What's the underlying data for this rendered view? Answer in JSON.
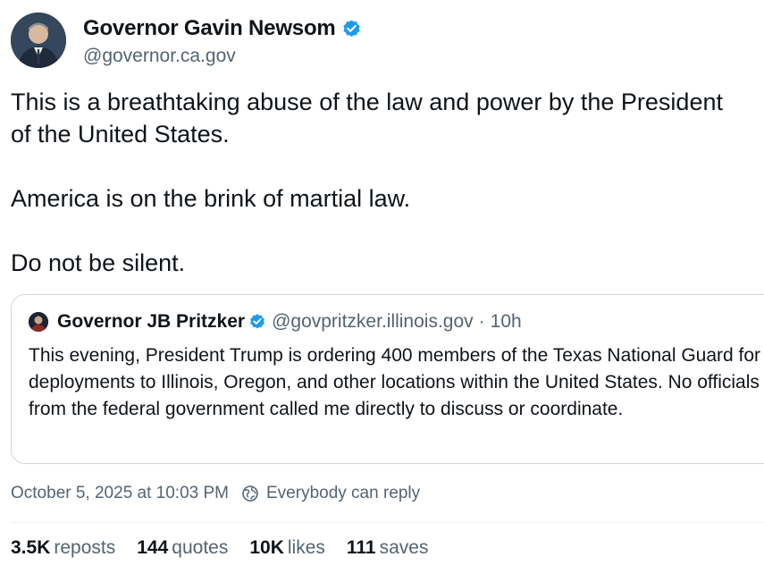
{
  "author": {
    "display_name": "Governor Gavin Newsom",
    "handle": "@governor.ca.gov",
    "verified_icon": "verified-badge-icon",
    "accent_color": "#1d9bf0"
  },
  "post": {
    "paragraphs": [
      "This is a breathtaking abuse of the law and power by the President of the United States.",
      "America is on the brink of martial law.",
      "Do not be silent."
    ]
  },
  "quote": {
    "display_name": "Governor JB Pritzker",
    "handle": "@govpritzker.illinois.gov",
    "separator": "·",
    "time": "10h",
    "text": "This evening, President Trump is ordering 400 members of the Texas National Guard for deployments to Illinois, Oregon, and other locations within the United States. No officials from the federal government called me directly to discuss or coordinate."
  },
  "meta": {
    "timestamp": "October 5, 2025 at 10:03 PM",
    "reply_setting": "Everybody can reply",
    "reply_icon": "globe-icon"
  },
  "stats": [
    {
      "num": "3.5K",
      "label": "reposts"
    },
    {
      "num": "144",
      "label": "quotes"
    },
    {
      "num": "10K",
      "label": "likes"
    },
    {
      "num": "111",
      "label": "saves"
    }
  ]
}
